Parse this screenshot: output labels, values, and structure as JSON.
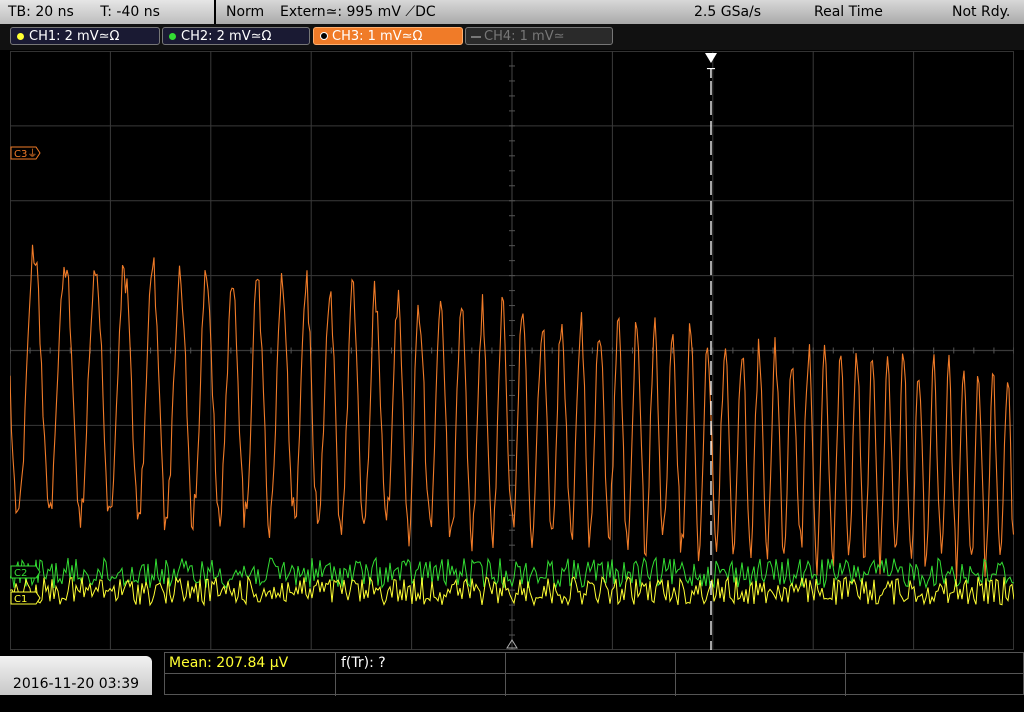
{
  "header": {
    "timebase": "TB: 20 ns",
    "trigger_time": "T: -40 ns",
    "mode": "Norm",
    "trigger": "Extern≃: 995 mV ⟋DC",
    "sample_rate": "2.5 GSa/s",
    "acq_mode": "Real Time",
    "status": "Not Rdy."
  },
  "channels": [
    {
      "label": "CH1: 2 mV≃Ω",
      "color": "#ffff33",
      "active": true
    },
    {
      "label": "CH2: 2 mV≃Ω",
      "color": "#33dd33",
      "active": true
    },
    {
      "label": "CH3: 1 mV≃Ω",
      "color": "#f07b28",
      "active": true,
      "selected": true
    },
    {
      "label": "CH4: 1 mV≃",
      "color": "#777777",
      "active": false
    }
  ],
  "markers": {
    "ch3_ref": "C3⏚",
    "ch2_ref": "C2",
    "ch1_ref": "C1",
    "trigger": "T"
  },
  "measurements": {
    "mean": "Mean: 207.84 µV",
    "freq": "f(Tr): ?"
  },
  "footer": {
    "datetime": "2016-11-20 03:39"
  },
  "colors": {
    "ch1": "#ffff33",
    "ch2": "#33dd33",
    "ch3": "#f07b28",
    "grid": "#3a3a3a"
  }
}
